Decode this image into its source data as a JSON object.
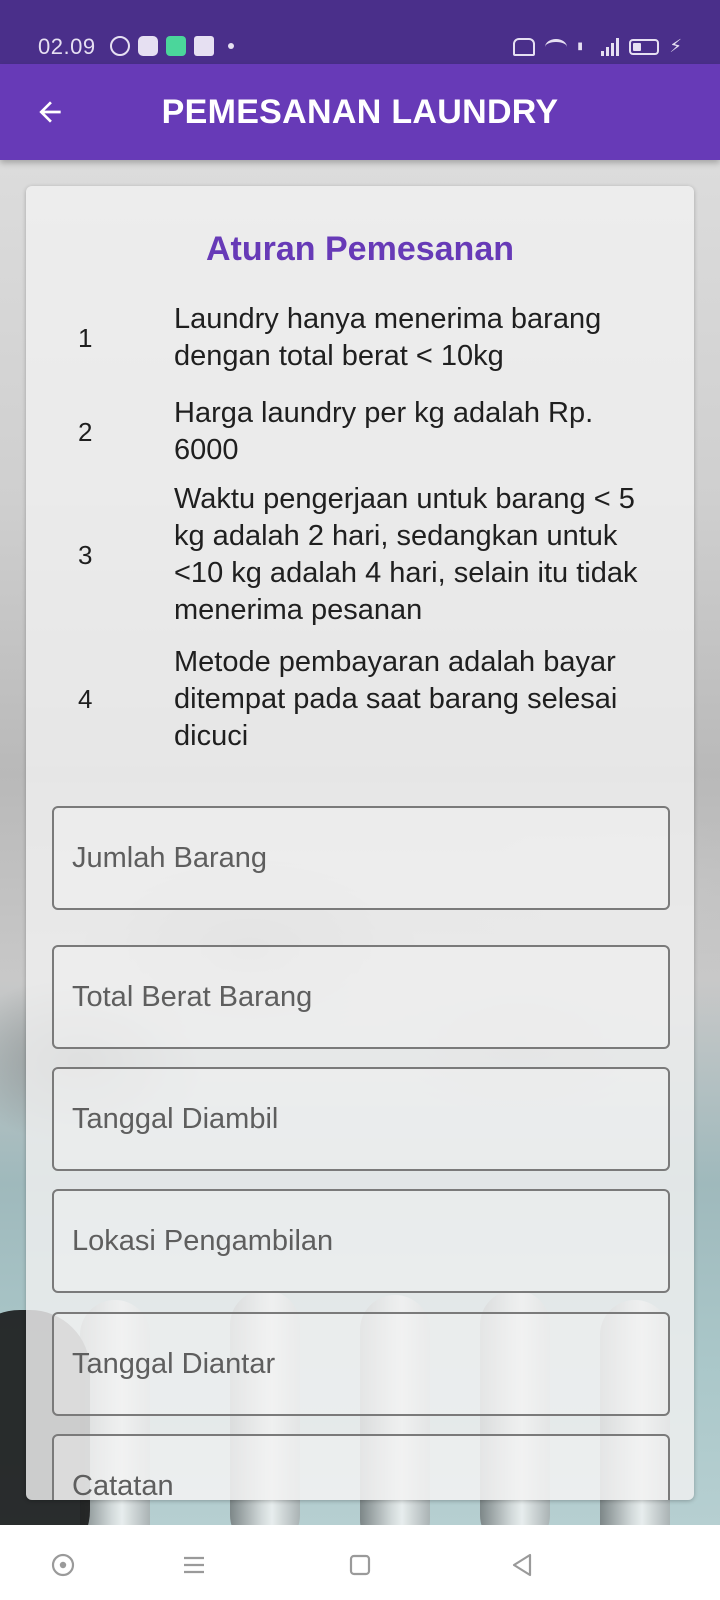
{
  "status_bar": {
    "time": "02.09",
    "left_icons": [
      "whatsapp-icon",
      "youtube-icon",
      "notification-app-icon",
      "facebook-icon",
      "more-dot-icon"
    ],
    "right_icons": [
      "vibrate-mute-icon",
      "wifi-icon",
      "volte-icon",
      "signal-icon",
      "battery-icon",
      "charging-icon"
    ]
  },
  "app_bar": {
    "title": "PEMESANAN LAUNDRY",
    "back_icon": "arrow-back-icon",
    "color": "#673ab7"
  },
  "rules": {
    "title": "Aturan Pemesanan",
    "items": [
      {
        "number": "1",
        "text": "Laundry hanya menerima barang dengan total berat < 10kg"
      },
      {
        "number": "2",
        "text": "Harga laundry per kg adalah Rp. 6000"
      },
      {
        "number": "3",
        "text": "Waktu pengerjaan untuk barang < 5 kg adalah 2 hari, sedangkan untuk <10 kg adalah 4 hari, selain itu tidak menerima pesanan"
      },
      {
        "number": "4",
        "text": "Metode pembayaran adalah bayar ditempat pada saat barang selesai dicuci"
      }
    ]
  },
  "form": {
    "jumlah_barang": {
      "placeholder": "Jumlah Barang",
      "value": ""
    },
    "total_berat": {
      "placeholder": "Total Berat Barang",
      "value": ""
    },
    "tanggal_diambil": {
      "placeholder": "Tanggal Diambil",
      "value": ""
    },
    "lokasi_pengambilan": {
      "placeholder": "Lokasi Pengambilan",
      "value": ""
    },
    "tanggal_diantar": {
      "placeholder": "Tanggal Diantar",
      "value": ""
    },
    "catatan": {
      "placeholder": "Catatan",
      "value": ""
    }
  },
  "nav_bar": {
    "icons": [
      "assistant-icon",
      "menu-icon",
      "home-icon",
      "back-icon"
    ]
  }
}
